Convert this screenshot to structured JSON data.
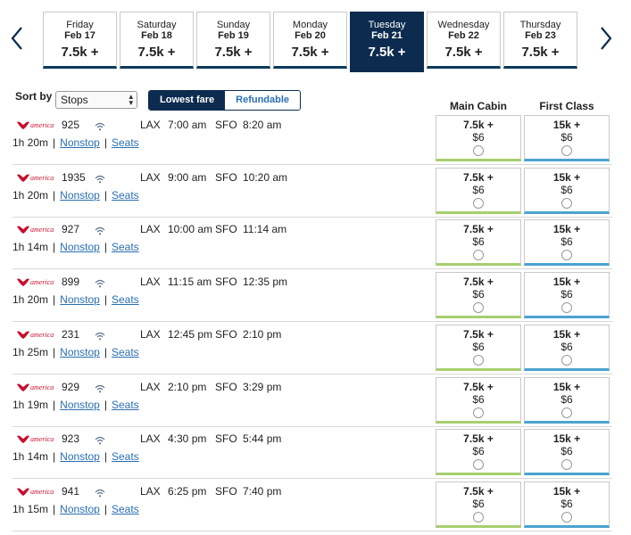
{
  "dates": [
    {
      "day": "Friday",
      "date": "Feb 17",
      "fare": "7.5k +"
    },
    {
      "day": "Saturday",
      "date": "Feb 18",
      "fare": "7.5k +"
    },
    {
      "day": "Sunday",
      "date": "Feb 19",
      "fare": "7.5k +"
    },
    {
      "day": "Monday",
      "date": "Feb 20",
      "fare": "7.5k +"
    },
    {
      "day": "Tuesday",
      "date": "Feb 21",
      "fare": "7.5k +",
      "active": true
    },
    {
      "day": "Wednesday",
      "date": "Feb 22",
      "fare": "7.5k +"
    },
    {
      "day": "Thursday",
      "date": "Feb 23",
      "fare": "7.5k +"
    }
  ],
  "controls": {
    "sort_label": "Sort by",
    "sort_value": "Stops",
    "toggle_on": "Lowest fare",
    "toggle_off": "Refundable"
  },
  "columns": {
    "main": "Main Cabin",
    "first": "First Class"
  },
  "brand": {
    "name": "america",
    "color": "#c8102e"
  },
  "colors": {
    "navy": "#0c2b4e",
    "link": "#2a6fb0",
    "main_bar": "#a6cf6e",
    "first_bar": "#4aa3cf"
  },
  "icons": {
    "prev": "chevron-left-icon",
    "next": "chevron-right-icon",
    "wifi": "wifi-icon"
  },
  "flights": [
    {
      "flight": "925",
      "from": "LAX",
      "dep": "7:00 am",
      "to": "SFO",
      "arr": "8:20 am",
      "duration": "1h 20m",
      "stops": "Nonstop",
      "seats": "Seats",
      "main_pts": "7.5k +",
      "main_usd": "$6",
      "first_pts": "15k +",
      "first_usd": "$6"
    },
    {
      "flight": "1935",
      "from": "LAX",
      "dep": "9:00 am",
      "to": "SFO",
      "arr": "10:20 am",
      "duration": "1h 20m",
      "stops": "Nonstop",
      "seats": "Seats",
      "main_pts": "7.5k +",
      "main_usd": "$6",
      "first_pts": "15k +",
      "first_usd": "$6"
    },
    {
      "flight": "927",
      "from": "LAX",
      "dep": "10:00 am",
      "to": "SFO",
      "arr": "11:14 am",
      "duration": "1h 14m",
      "stops": "Nonstop",
      "seats": "Seats",
      "main_pts": "7.5k +",
      "main_usd": "$6",
      "first_pts": "15k +",
      "first_usd": "$6"
    },
    {
      "flight": "899",
      "from": "LAX",
      "dep": "11:15 am",
      "to": "SFO",
      "arr": "12:35 pm",
      "duration": "1h 20m",
      "stops": "Nonstop",
      "seats": "Seats",
      "main_pts": "7.5k +",
      "main_usd": "$6",
      "first_pts": "15k +",
      "first_usd": "$6"
    },
    {
      "flight": "231",
      "from": "LAX",
      "dep": "12:45 pm",
      "to": "SFO",
      "arr": "2:10 pm",
      "duration": "1h 25m",
      "stops": "Nonstop",
      "seats": "Seats",
      "main_pts": "7.5k +",
      "main_usd": "$6",
      "first_pts": "15k +",
      "first_usd": "$6"
    },
    {
      "flight": "929",
      "from": "LAX",
      "dep": "2:10 pm",
      "to": "SFO",
      "arr": "3:29 pm",
      "duration": "1h 19m",
      "stops": "Nonstop",
      "seats": "Seats",
      "main_pts": "7.5k +",
      "main_usd": "$6",
      "first_pts": "15k +",
      "first_usd": "$6"
    },
    {
      "flight": "923",
      "from": "LAX",
      "dep": "4:30 pm",
      "to": "SFO",
      "arr": "5:44 pm",
      "duration": "1h 14m",
      "stops": "Nonstop",
      "seats": "Seats",
      "main_pts": "7.5k +",
      "main_usd": "$6",
      "first_pts": "15k +",
      "first_usd": "$6"
    },
    {
      "flight": "941",
      "from": "LAX",
      "dep": "6:25 pm",
      "to": "SFO",
      "arr": "7:40 pm",
      "duration": "1h 15m",
      "stops": "Nonstop",
      "seats": "Seats",
      "main_pts": "7.5k +",
      "main_usd": "$6",
      "first_pts": "15k +",
      "first_usd": "$6"
    }
  ]
}
